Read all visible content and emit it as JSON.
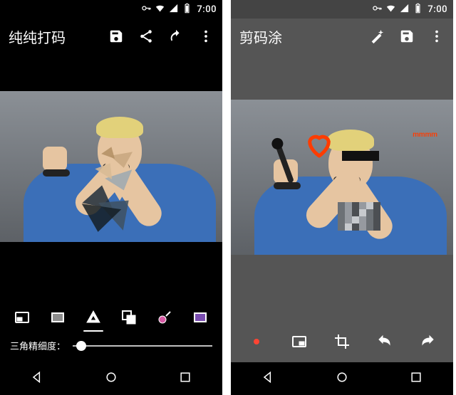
{
  "status_time": "7:00",
  "left": {
    "title": "纯纯打码",
    "actions": {
      "save": "save-icon",
      "share": "share-icon",
      "undo": "undo-icon",
      "overflow": "more-icon"
    },
    "tools": [
      {
        "name": "pip-tool",
        "selected": false
      },
      {
        "name": "fill-tool",
        "selected": false
      },
      {
        "name": "shape-tool",
        "selected": true
      },
      {
        "name": "layers-tool",
        "selected": false
      },
      {
        "name": "brush-tool",
        "selected": false
      },
      {
        "name": "frame-tool",
        "selected": false
      }
    ],
    "slider_label": "三角精细度：",
    "slider_value": 6
  },
  "right": {
    "title": "剪码涂",
    "actions": {
      "magic": "magic-wand-icon",
      "save": "save-icon",
      "overflow": "more-icon"
    },
    "annotation_text": "mmmm",
    "tools": [
      {
        "name": "record-indicator"
      },
      {
        "name": "pip-tool"
      },
      {
        "name": "crop-tool"
      },
      {
        "name": "undo-tool"
      },
      {
        "name": "redo-tool"
      }
    ]
  },
  "nav": {
    "back": "back-icon",
    "home": "home-icon",
    "recent": "recent-icon"
  }
}
